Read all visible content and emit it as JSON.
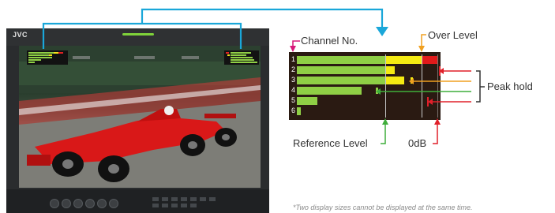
{
  "monitor": {
    "brand": "JVC"
  },
  "meter": {
    "channels": [
      "1",
      "2",
      "3",
      "4",
      "5",
      "6"
    ]
  },
  "labels": {
    "channel_no": "Channel No.",
    "over_level": "Over Level",
    "peak_hold": "Peak hold",
    "reference_level": "Reference Level",
    "zero_db": "0dB"
  },
  "footnote": "*Two display sizes cannot be displayed at the same time.",
  "colors": {
    "callout_blue": "#1aa7d9",
    "channel_magenta": "#d8187a",
    "over_orange": "#f0a020",
    "peak_red": "#e0202a",
    "reference_green": "#3fae3b",
    "meter_green": "#8fcf45",
    "meter_yellow": "#f5ea12",
    "meter_red": "#e11a1a"
  }
}
